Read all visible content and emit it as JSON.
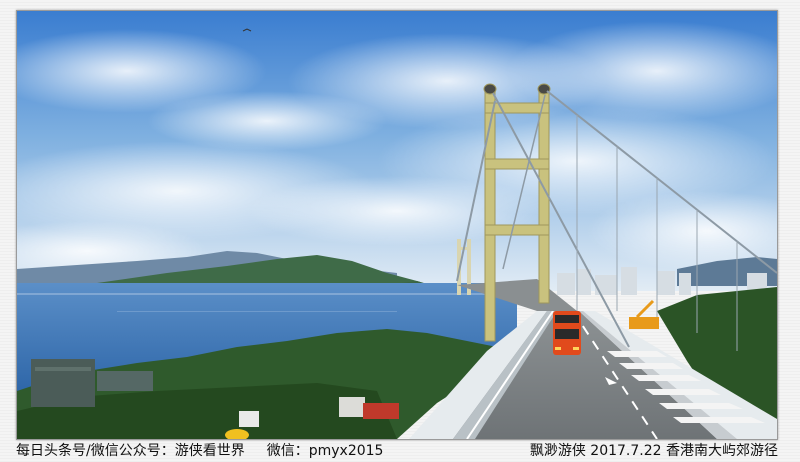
{
  "caption": {
    "left_text": "每日头条号/微信公众号：游侠看世界",
    "wechat_text": "微信：pmyx2015",
    "right_text": "飘渺游侠  2017.7.22  香港南大屿郊游径"
  },
  "photo": {
    "subject": "bridge-photo",
    "colors": {
      "sky_top": "#3d7fd0",
      "sky_bottom": "#dbe8f4",
      "sea": "#3d76b8",
      "hills": "#3c6a46",
      "bridge_tower": "#c9c27e",
      "road": "#7c8184",
      "bus": "#e14a1c"
    }
  }
}
